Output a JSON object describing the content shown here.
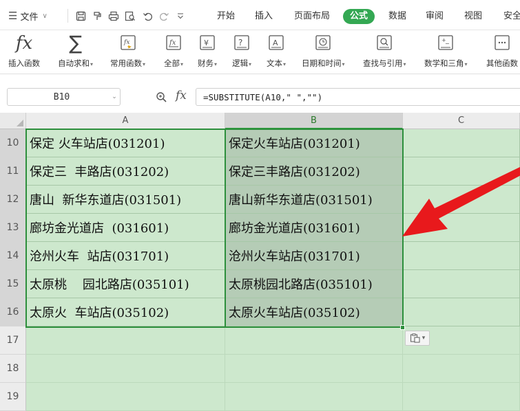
{
  "menubar": {
    "file_label": "文件",
    "tabs": [
      "开始",
      "插入",
      "页面布局",
      "公式",
      "数据",
      "审阅",
      "视图",
      "安全"
    ],
    "active_tab": "公式"
  },
  "ribbon": {
    "items": [
      {
        "label": "插入函数",
        "icon": "fx-icon",
        "dropdown": false
      },
      {
        "label": "自动求和",
        "icon": "sigma-icon",
        "dropdown": true
      },
      {
        "label": "常用函数",
        "icon": "common-functions-icon",
        "dropdown": true
      },
      {
        "label": "全部",
        "icon": "all-functions-icon",
        "dropdown": true
      },
      {
        "label": "财务",
        "icon": "finance-icon",
        "dropdown": true
      },
      {
        "label": "逻辑",
        "icon": "logic-icon",
        "dropdown": true
      },
      {
        "label": "文本",
        "icon": "text-icon",
        "dropdown": true
      },
      {
        "label": "日期和时间",
        "icon": "datetime-icon",
        "dropdown": true
      },
      {
        "label": "查找与引用",
        "icon": "lookup-icon",
        "dropdown": true
      },
      {
        "label": "数学和三角",
        "icon": "math-icon",
        "dropdown": true
      },
      {
        "label": "其他函数",
        "icon": "other-functions-icon",
        "dropdown": false
      }
    ]
  },
  "formula_bar": {
    "name_box": "B10",
    "fx_label": "fx",
    "formula": "=SUBSTITUTE(A10,\" \",\"\")"
  },
  "grid": {
    "columns": [
      "A",
      "B",
      "C"
    ],
    "selected_column": "B",
    "rows": [
      {
        "num": "10",
        "a": "保定 火车站店(031201)",
        "b": "保定火车站店(031201)"
      },
      {
        "num": "11",
        "a": "保定三  丰路店(031202)",
        "b": "保定三丰路店(031202)"
      },
      {
        "num": "12",
        "a": "唐山  新华东道店(031501)",
        "b": "唐山新华东道店(031501)"
      },
      {
        "num": "13",
        "a": "廊坊金光道店  (031601)",
        "b": "廊坊金光道店(031601)"
      },
      {
        "num": "14",
        "a": "沧州火车  站店(031701)",
        "b": "沧州火车站店(031701)"
      },
      {
        "num": "15",
        "a": "太原桃    园北路店(035101)",
        "b": "太原桃园北路店(035101)"
      },
      {
        "num": "16",
        "a": "太原火  车站店(035102)",
        "b": "太原火车站店(035102)"
      }
    ],
    "empty_rows": [
      "17",
      "18",
      "19"
    ]
  },
  "colors": {
    "accent": "#34a853",
    "selection_border": "#2d8f3c",
    "cell_bg": "#cde8cd",
    "selected_cell_bg": "#b5ccb6",
    "arrow": "#e8191c"
  }
}
